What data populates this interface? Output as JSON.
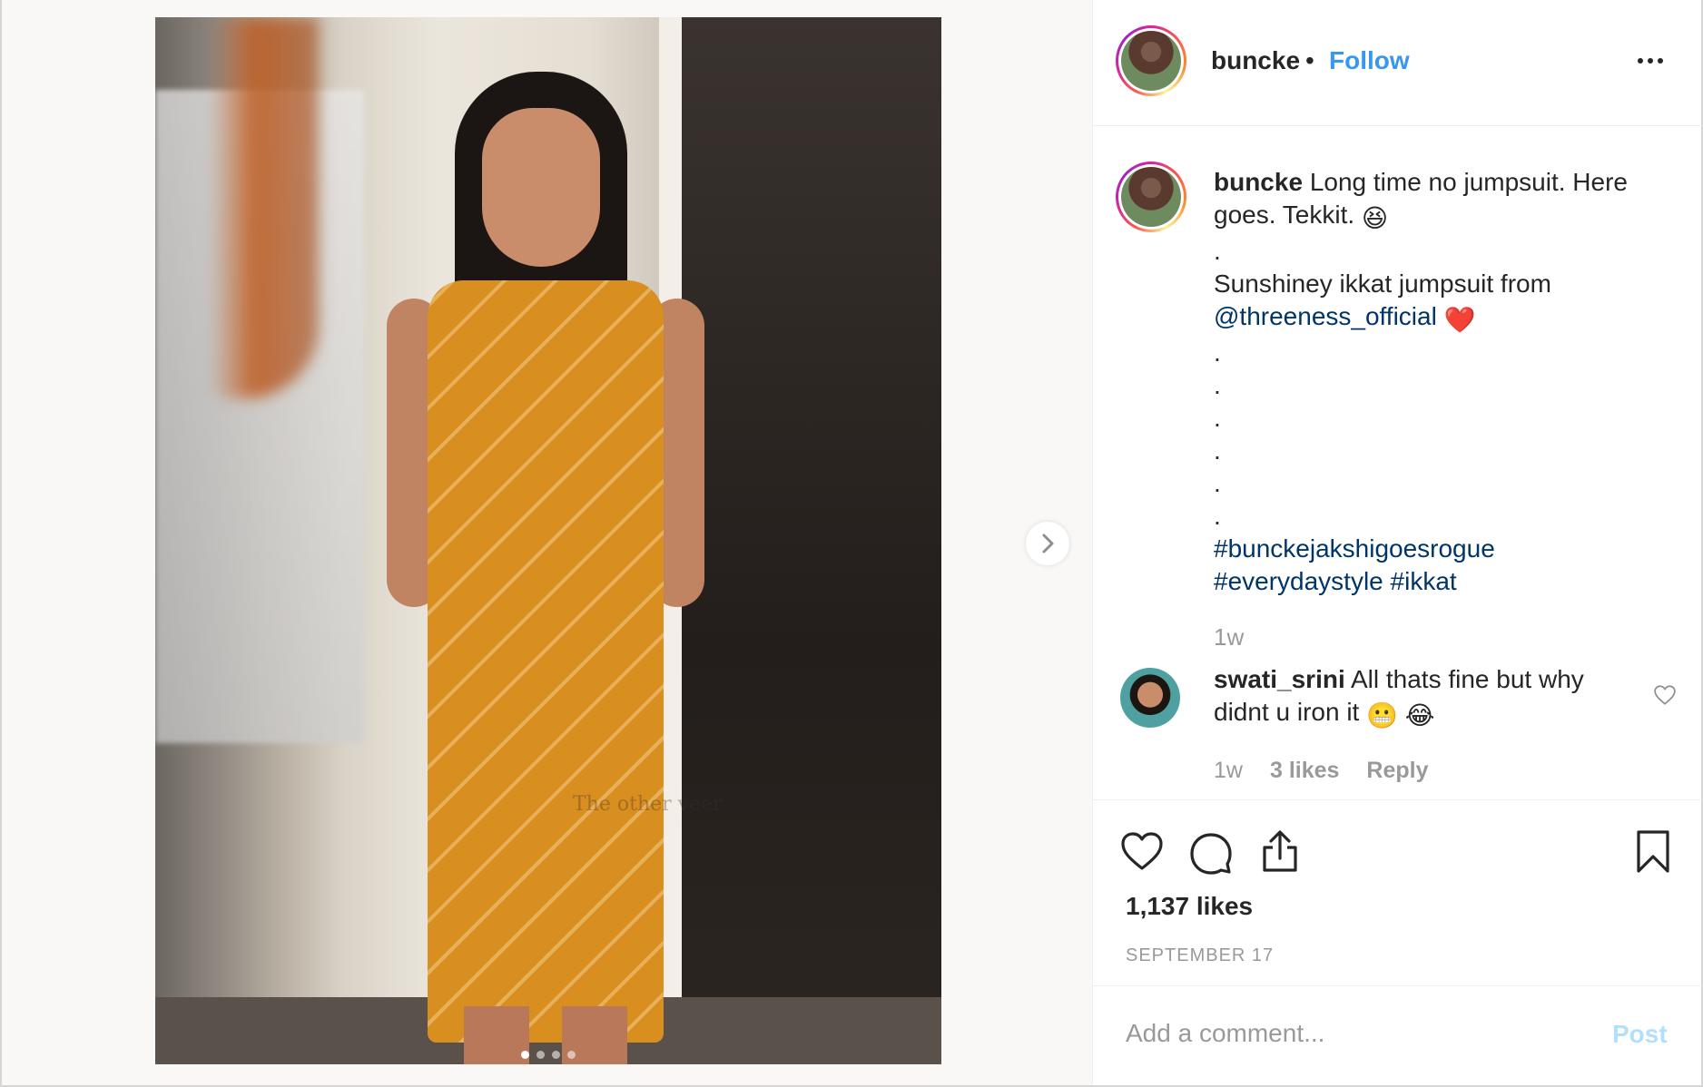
{
  "post": {
    "username": "buncke",
    "bullet": "•",
    "follow_label": "Follow",
    "watermark": "The other veer"
  },
  "caption": {
    "username": "buncke",
    "text_1": "Long time no jumpsuit. Here goes. Tekkit.",
    "emoji_1": "😆",
    "dot": ".",
    "text_2": "Sunshiney ikkat jumpsuit from",
    "mention": "@threeness_official",
    "emoji_2": "❤️",
    "hashtag_1": "#bunckejakshigoesrogue",
    "hashtag_2": "#everydaystyle",
    "hashtag_3": "#ikkat",
    "time": "1w"
  },
  "comment": {
    "username": "swati_srini",
    "text": "All thats fine but why didnt u iron it",
    "emojis": "😬 😂",
    "time": "1w",
    "likes": "3 likes",
    "reply": "Reply"
  },
  "stats": {
    "likes": "1,137 likes",
    "date": "SEPTEMBER 17"
  },
  "add_comment": {
    "placeholder": "Add a comment...",
    "post_label": "Post"
  },
  "carousel": {
    "slide_count": 4,
    "active_index": 0
  },
  "colors": {
    "link_blue": "#3897f0",
    "hashtag_blue": "#003569",
    "muted": "#999999",
    "post_disabled": "#b2dffc"
  },
  "icons": {
    "more": "more-options-icon",
    "next": "chevron-right-icon",
    "like": "heart-icon",
    "comment": "comment-bubble-icon",
    "share": "share-icon",
    "save": "bookmark-icon"
  }
}
